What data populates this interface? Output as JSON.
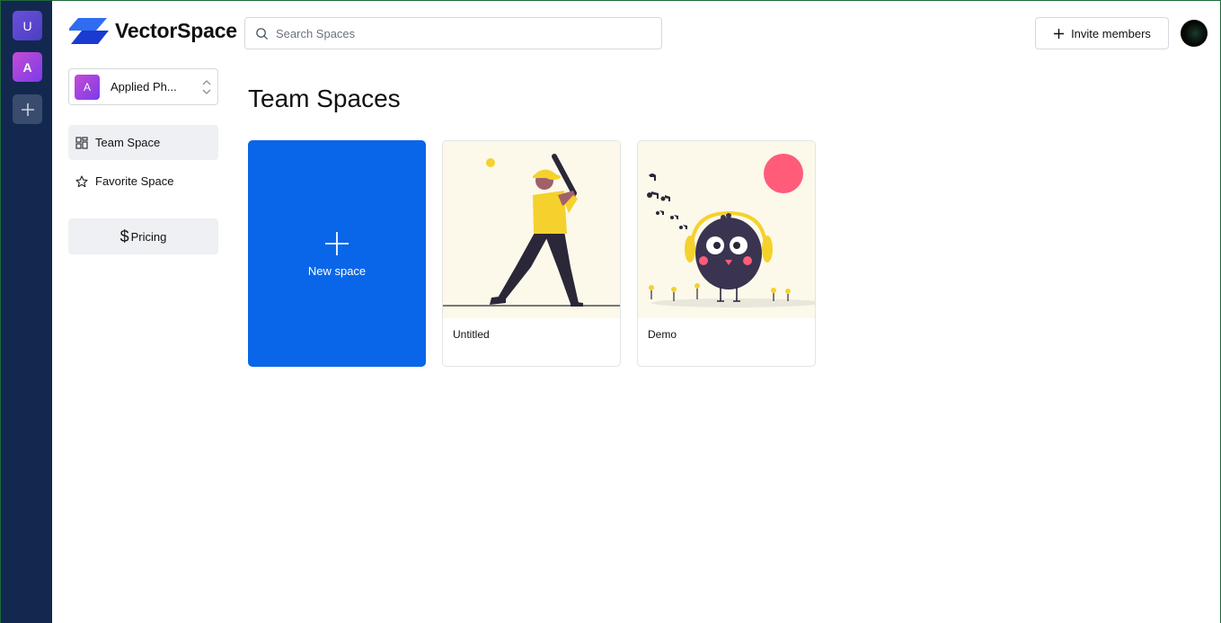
{
  "workspaces_rail": {
    "items": [
      {
        "initial": "U"
      },
      {
        "initial": "A"
      }
    ],
    "add_icon": "plus-icon"
  },
  "header": {
    "logo_text": "VectorSpace",
    "search_placeholder": "Search Spaces",
    "invite_label": "Invite members",
    "invite_icon": "plus-icon"
  },
  "sidebar": {
    "workspace": {
      "initial": "A",
      "name": "Applied Ph..."
    },
    "nav": [
      {
        "label": "Team Space",
        "icon": "grid-icon",
        "active": true
      },
      {
        "label": "Favorite Space",
        "icon": "star-icon",
        "active": false
      }
    ],
    "pricing_symbol": "$",
    "pricing_label": "Pricing"
  },
  "main": {
    "title": "Team Spaces",
    "new_space_label": "New space",
    "spaces": [
      {
        "name": "Untitled",
        "illustration": "baseball-player-illustration"
      },
      {
        "name": "Demo",
        "illustration": "music-bird-illustration"
      }
    ]
  },
  "colors": {
    "rail_bg": "#13284f",
    "accent": "#0a66e8",
    "card_illustration_bg": "#fcf9ea"
  }
}
